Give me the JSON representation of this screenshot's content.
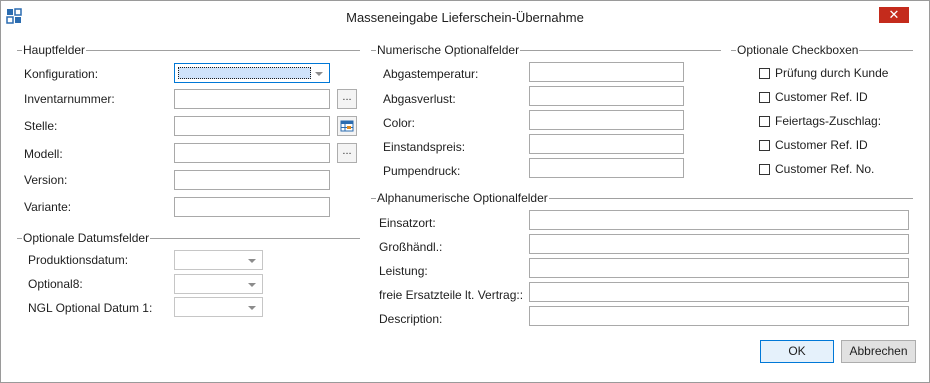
{
  "window": {
    "title": "Masseneingabe Lieferschein-Übernahme",
    "close_glyph": "✕"
  },
  "groups": {
    "hauptfelder": "Hauptfelder",
    "datumsfelder": "Optionale Datumsfelder",
    "numerische": "Numerische Optionalfelder",
    "checkboxen": "Optionale Checkboxen",
    "alphanumerische": "Alphanumerische Optionalfelder"
  },
  "hauptfelder": {
    "konfiguration": {
      "label": "Konfiguration:",
      "value": ""
    },
    "inventarnummer": {
      "label": "Inventarnummer:",
      "value": "",
      "button": "..."
    },
    "stelle": {
      "label": "Stelle:",
      "value": ""
    },
    "modell": {
      "label": "Modell:",
      "value": "",
      "button": "..."
    },
    "version": {
      "label": "Version:",
      "value": ""
    },
    "variante": {
      "label": "Variante:",
      "value": ""
    }
  },
  "datumsfelder": [
    {
      "label": "Produktionsdatum:",
      "value": ""
    },
    {
      "label": "Optional8:",
      "value": ""
    },
    {
      "label": "NGL Optional Datum 1:",
      "value": ""
    }
  ],
  "numerische": [
    {
      "label": "Abgastemperatur:",
      "value": ""
    },
    {
      "label": "Abgasverlust:",
      "value": ""
    },
    {
      "label": "Color:",
      "value": ""
    },
    {
      "label": "Einstandspreis:",
      "value": ""
    },
    {
      "label": "Pumpendruck:",
      "value": ""
    }
  ],
  "checkboxen": [
    {
      "label": "Prüfung durch Kunde",
      "checked": false
    },
    {
      "label": "Customer Ref. ID",
      "checked": false
    },
    {
      "label": "Feiertags-Zuschlag:",
      "checked": false
    },
    {
      "label": "Customer Ref. ID",
      "checked": false
    },
    {
      "label": "Customer Ref. No.",
      "checked": false
    }
  ],
  "alphanumerische": [
    {
      "label": "Einsatzort:",
      "value": ""
    },
    {
      "label": "Großhändl.:",
      "value": ""
    },
    {
      "label": "Leistung:",
      "value": ""
    },
    {
      "label": "freie Ersatzteile lt. Vertrag::",
      "value": ""
    },
    {
      "label": "Description:",
      "value": ""
    }
  ],
  "buttons": {
    "ok": "OK",
    "cancel": "Abbrechen"
  },
  "colors": {
    "close": "#c42b1c",
    "focus": "#0078d7",
    "accent_icon": "#2b6cb0"
  }
}
